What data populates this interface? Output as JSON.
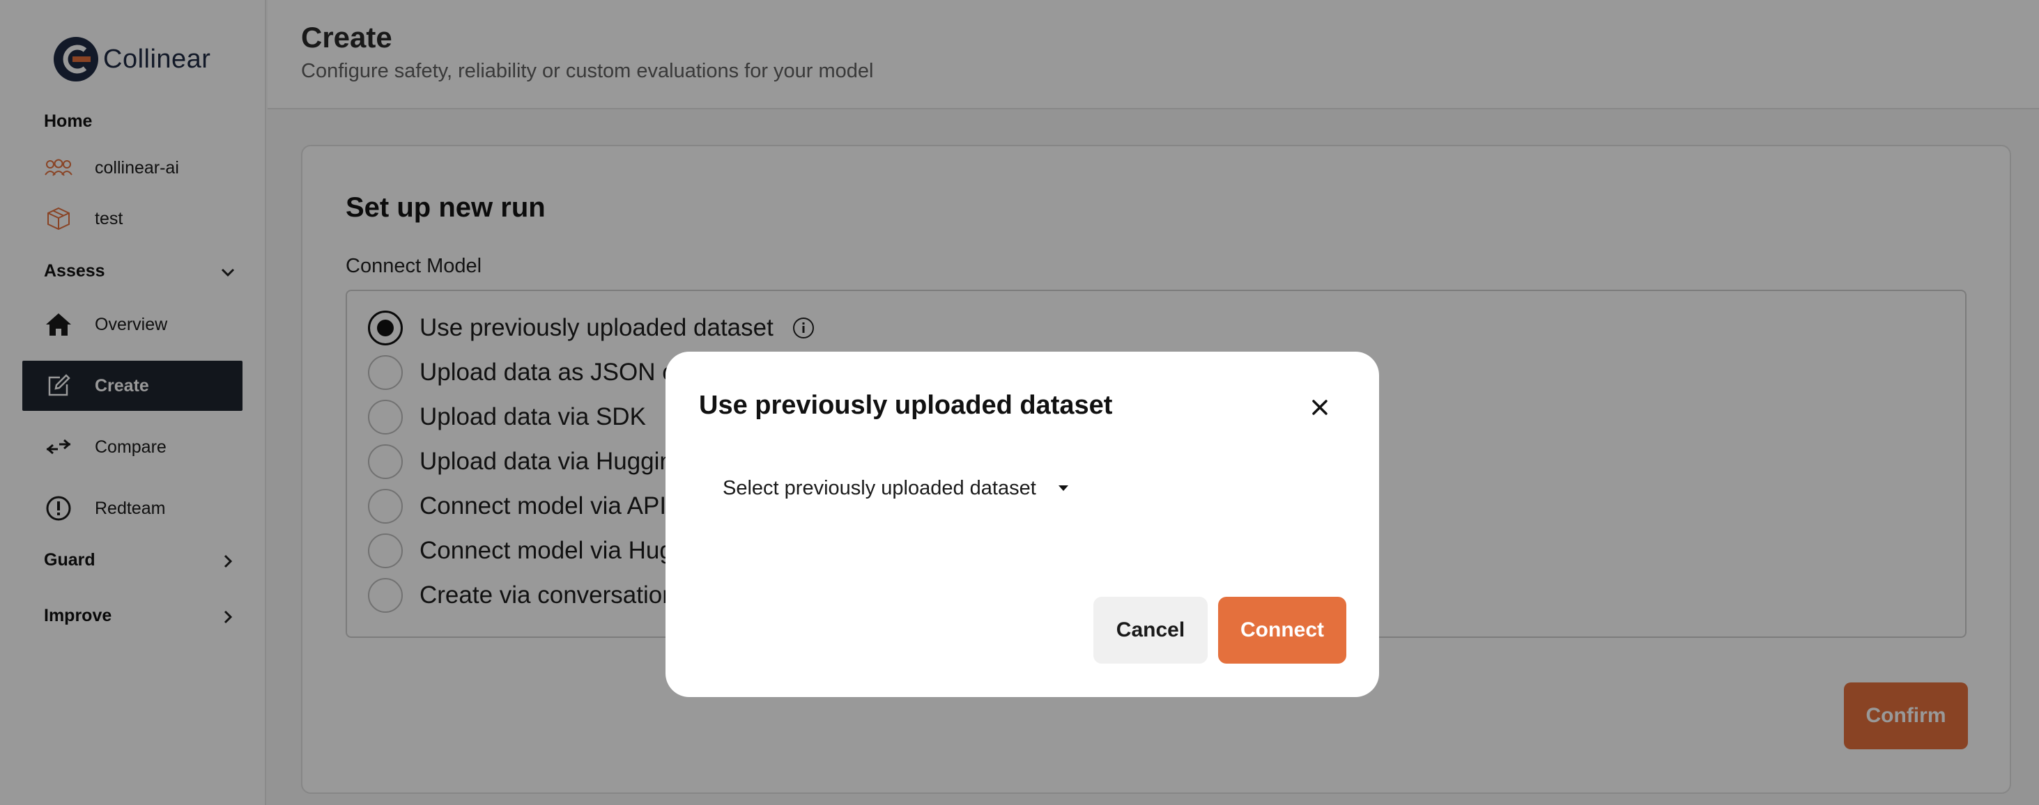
{
  "app": {
    "logo_text": "Collinear",
    "accent_color": "#e4703d",
    "dark_color": "#1e2530"
  },
  "sidebar": {
    "home_label": "Home",
    "workspaces": [
      {
        "label": "collinear-ai",
        "icon": "team-icon"
      },
      {
        "label": "test",
        "icon": "box-icon"
      }
    ],
    "assess_label": "Assess",
    "assess_items": [
      {
        "label": "Overview",
        "icon": "home-icon"
      },
      {
        "label": "Create",
        "icon": "edit-icon",
        "active": true
      },
      {
        "label": "Compare",
        "icon": "compare-icon"
      },
      {
        "label": "Redteam",
        "icon": "alert-circle-icon"
      }
    ],
    "guard_label": "Guard",
    "improve_label": "Improve"
  },
  "header": {
    "title": "Create",
    "subtitle": "Configure safety, reliability or custom evaluations for your model"
  },
  "main": {
    "card_title": "Set up new run",
    "section_label": "Connect Model",
    "options": [
      {
        "label": "Use previously uploaded dataset",
        "selected": true
      },
      {
        "label": "Upload data as JSON o"
      },
      {
        "label": "Upload data via SDK"
      },
      {
        "label": "Upload data via Huggin"
      },
      {
        "label": "Connect model via API"
      },
      {
        "label": "Connect model via Hug"
      },
      {
        "label": "Create via conversation"
      }
    ],
    "confirm_label": "Confirm"
  },
  "modal": {
    "title": "Use previously uploaded dataset",
    "select_placeholder": "Select previously uploaded dataset",
    "cancel_label": "Cancel",
    "connect_label": "Connect"
  }
}
